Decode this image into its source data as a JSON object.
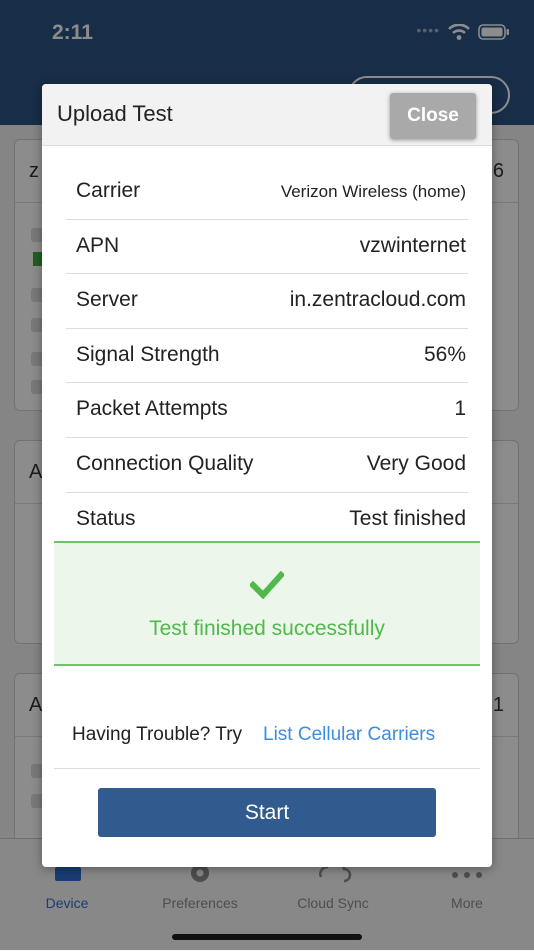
{
  "status_bar": {
    "time": "2:11"
  },
  "background": {
    "cards": [
      {
        "title": "z",
        "number": "6"
      },
      {
        "title": "A",
        "number": ""
      },
      {
        "title": "A",
        "number": "1"
      }
    ],
    "tabs": [
      "Device",
      "Preferences",
      "Cloud Sync",
      "More"
    ]
  },
  "modal": {
    "title": "Upload Test",
    "close_label": "Close",
    "rows": [
      {
        "label": "Carrier",
        "value": "Verizon Wireless (home)"
      },
      {
        "label": "APN",
        "value": "vzwinternet"
      },
      {
        "label": "Server",
        "value": "in.zentracloud.com"
      },
      {
        "label": "Signal Strength",
        "value": "56%"
      },
      {
        "label": "Packet Attempts",
        "value": "1"
      },
      {
        "label": "Connection Quality",
        "value": "Very Good"
      },
      {
        "label": "Status",
        "value": "Test finished"
      }
    ],
    "success_message": "Test finished successfully",
    "trouble_text": "Having Trouble? Try",
    "carriers_link": "List Cellular Carriers",
    "start_label": "Start"
  },
  "colors": {
    "header": "#2c5282",
    "success": "#4fb94c",
    "link": "#3a8ee0",
    "start_button": "#315b8e"
  }
}
